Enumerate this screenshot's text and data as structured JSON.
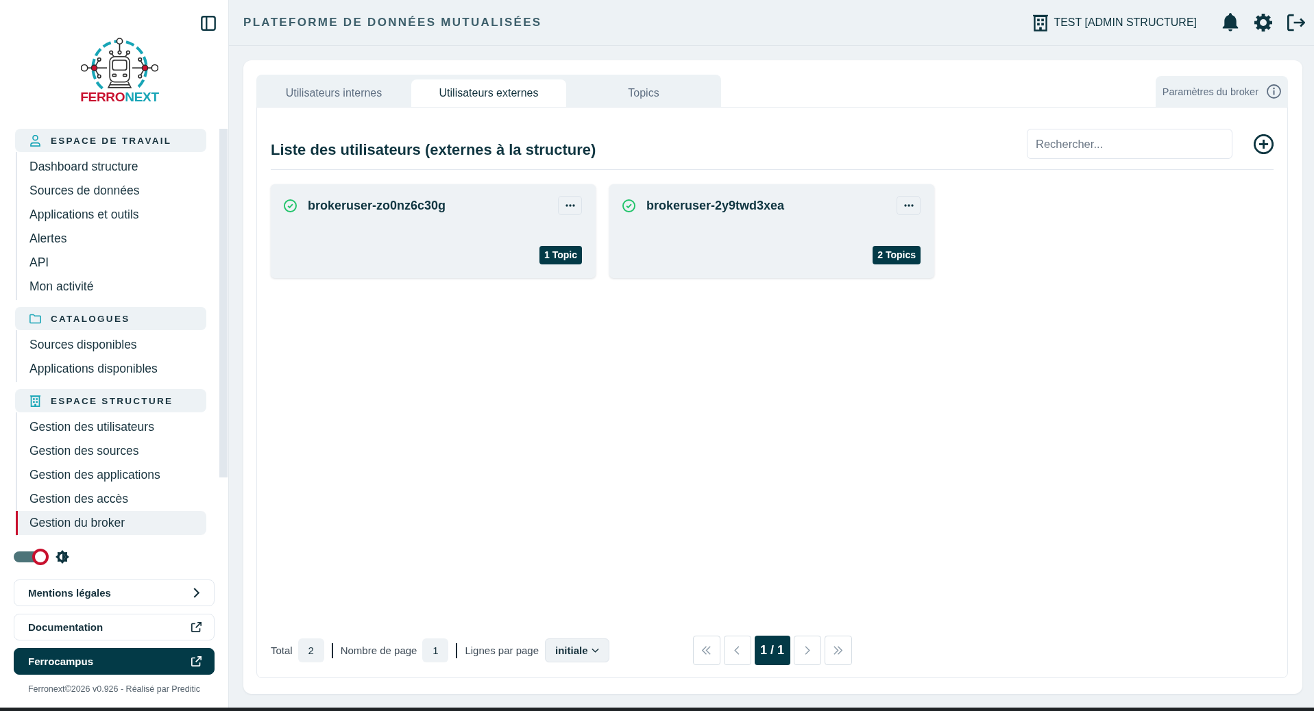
{
  "sidebar": {
    "logo": {
      "wordmark": [
        "FERRO",
        "NEXT"
      ]
    },
    "sections": [
      {
        "kind": "workspace",
        "title": "ESPACE DE TRAVAIL",
        "items": [
          {
            "label": "Dashboard structure",
            "selected": false
          },
          {
            "label": "Sources de données",
            "selected": false
          },
          {
            "label": "Applications et outils",
            "selected": false
          },
          {
            "label": "Alertes",
            "selected": false
          },
          {
            "label": "API",
            "selected": false
          },
          {
            "label": "Mon activité",
            "selected": false
          }
        ]
      },
      {
        "kind": "catalog",
        "title": "CATALOGUES",
        "items": [
          {
            "label": "Sources disponibles",
            "selected": false
          },
          {
            "label": "Applications disponibles",
            "selected": false
          }
        ]
      },
      {
        "kind": "structure",
        "title": "ESPACE STRUCTURE",
        "items": [
          {
            "label": "Gestion des utilisateurs",
            "selected": false
          },
          {
            "label": "Gestion des sources",
            "selected": false
          },
          {
            "label": "Gestion des applications",
            "selected": false
          },
          {
            "label": "Gestion des accès",
            "selected": false
          },
          {
            "label": "Gestion du broker",
            "selected": true
          }
        ]
      }
    ],
    "theme_toggle": {
      "on": true
    },
    "links": [
      {
        "label": "Mentions légales",
        "kind": "internal",
        "highlighted": false
      },
      {
        "label": "Documentation",
        "kind": "external",
        "highlighted": false
      },
      {
        "label": "Ferrocampus",
        "kind": "external",
        "highlighted": true
      }
    ],
    "footer": "Ferronext©2026 v0.926 - Réalisé par Preditic"
  },
  "header": {
    "title": "PLATEFORME DE DONNÉES MUTUALISÉES",
    "account": "TEST [ADMIN STRUCTURE]"
  },
  "tabs": [
    {
      "label": "Utilisateurs internes",
      "selected": false
    },
    {
      "label": "Utilisateurs externes",
      "selected": true
    },
    {
      "label": "Topics",
      "selected": false
    }
  ],
  "broker_tab": {
    "label": "Paramètres du broker"
  },
  "list": {
    "title": "Liste des utilisateurs (externes à la structure)",
    "search": {
      "placeholder": "Rechercher..."
    },
    "users": [
      {
        "name": "brokeruser-zo0nz6c30g",
        "active": true,
        "badge": "1 Topic"
      },
      {
        "name": "brokeruser-2y9twd3xea",
        "active": true,
        "badge": "2 Topics"
      }
    ]
  },
  "pagination": {
    "total_label": "Total",
    "total": "2",
    "pages_label": "Nombre de page",
    "pages": "1",
    "rows_label": "Lignes par page",
    "rows": "initiale",
    "current": "1 / 1",
    "buttons": [
      {
        "kind": "first",
        "disabled": true
      },
      {
        "kind": "previous",
        "disabled": true
      },
      {
        "kind": "next",
        "disabled": true
      },
      {
        "kind": "last",
        "disabled": true
      }
    ]
  }
}
